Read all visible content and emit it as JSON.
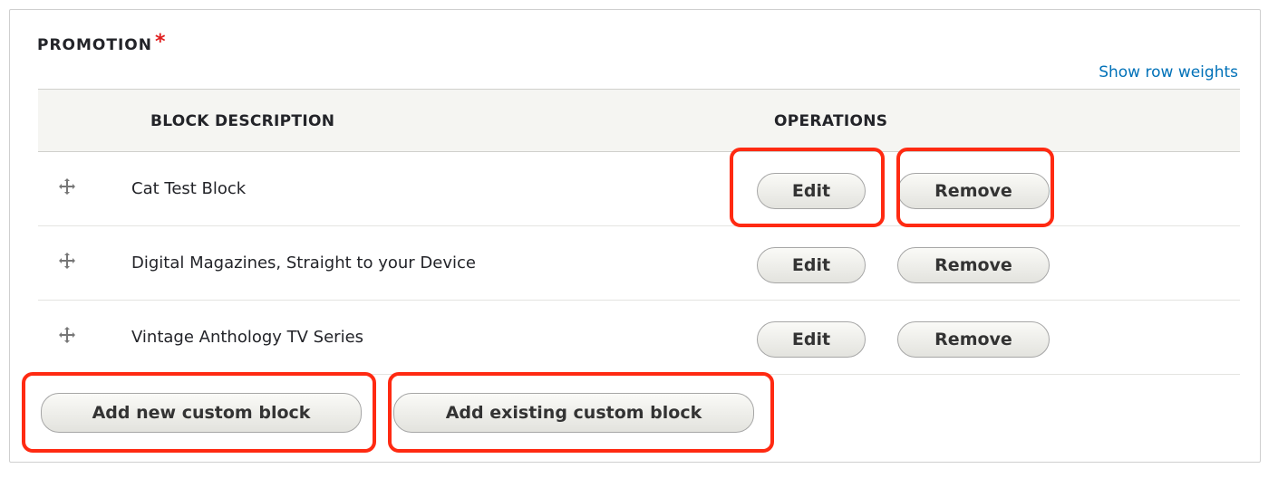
{
  "fieldset": {
    "legend": "PROMOTION",
    "required_marker": "*",
    "show_row_weights": "Show row weights"
  },
  "table": {
    "columns": [
      "BLOCK DESCRIPTION",
      "OPERATIONS"
    ],
    "rows": [
      {
        "title": "Cat Test Block",
        "edit": "Edit",
        "remove": "Remove"
      },
      {
        "title": "Digital Magazines, Straight to your Device",
        "edit": "Edit",
        "remove": "Remove"
      },
      {
        "title": "Vintage Anthology TV Series",
        "edit": "Edit",
        "remove": "Remove"
      }
    ]
  },
  "actions": {
    "add_new": "Add new custom block",
    "add_existing": "Add existing custom block"
  },
  "colors": {
    "link": "#0071b8",
    "required": "#e01e1e",
    "highlight": "#ff2a12"
  },
  "icons": {
    "drag_handle": "drag-handle-icon"
  }
}
